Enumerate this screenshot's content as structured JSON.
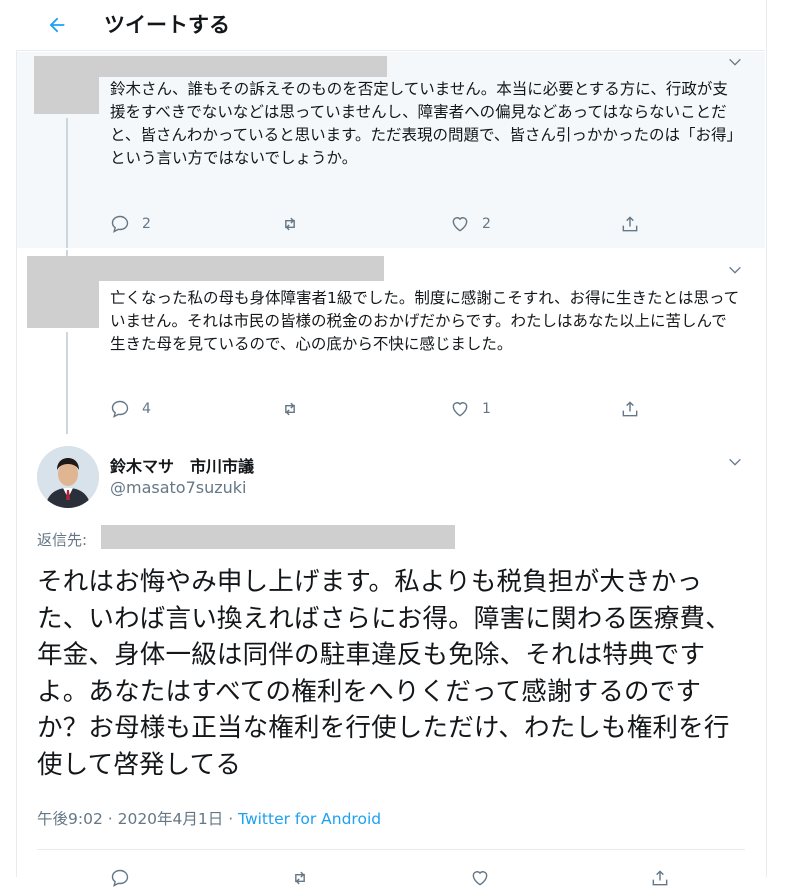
{
  "header": {
    "title": "ツイートする"
  },
  "colors": {
    "accent": "#1da1f2",
    "secondary": "#657786",
    "reply_bg": "#f5f8fa"
  },
  "replies": [
    {
      "text": "鈴木さん、誰もその訴えそのものを否定していません。本当に必要とする方に、行政が支援をすべきでないなどは思っていませんし、障害者への偏見などあってはならないことだと、皆さんわかっていると思います。ただ表現の問題で、皆さん引っかかったのは「お得」という言い方ではないでしょうか。",
      "counts": {
        "reply": "2",
        "retweet": "",
        "like": "2"
      }
    },
    {
      "text": "亡くなった私の母も身体障害者1級でした。制度に感謝こそすれ、お得に生きたとは思っていません。それは市民の皆様の税金のおかげだからです。わたしはあなた以上に苦しんで生きた母を見ているので、心の底から不快に感じました。",
      "counts": {
        "reply": "4",
        "retweet": "",
        "like": "1"
      }
    }
  ],
  "main_tweet": {
    "author_name": "鈴木マサ　市川市議",
    "author_handle": "@masato7suzuki",
    "reply_to_label": "返信先:",
    "text": "それはお悔やみ申し上げます。私よりも税負担が大きかった、いわば言い換えればさらにお得。障害に関わる医療費、年金、身体一級は同伴の駐車違反も免除、それは特典ですよ。あなたはすべての権利をへりくだって感謝するのですか？お母様も正当な権利を行使しただけ、わたしも権利を行使して啓発してる",
    "time": "午後9:02",
    "date": "2020年4月1日",
    "separator": " · ",
    "source": "Twitter for Android"
  }
}
